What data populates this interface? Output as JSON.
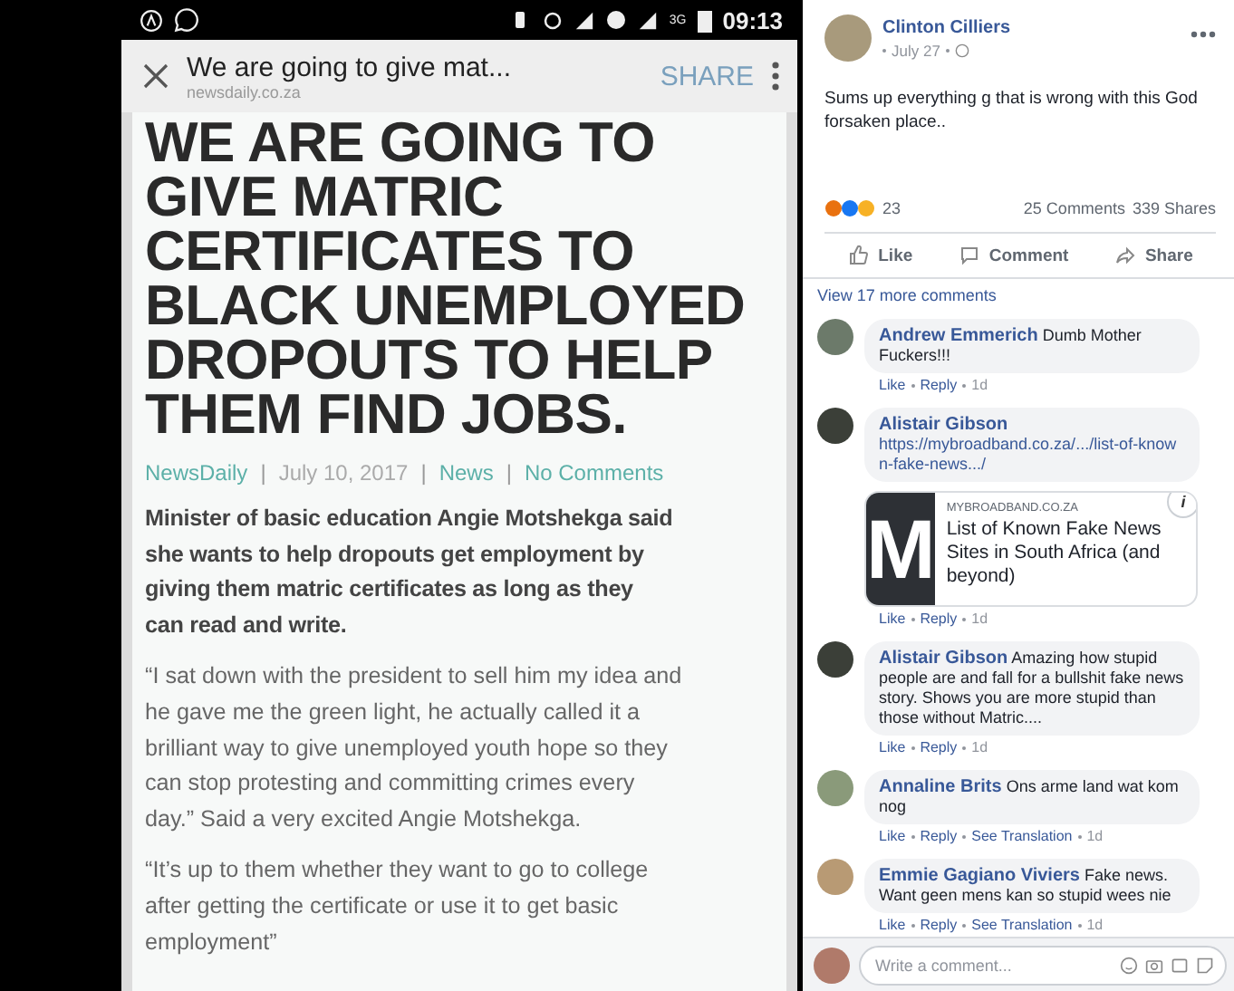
{
  "phone": {
    "status_bar": {
      "time": "09:13",
      "network": "3G"
    },
    "browser_bar": {
      "title": "We are going to give mat...",
      "url": "newsdaily.co.za",
      "share": "SHARE"
    },
    "article": {
      "headline": "WE ARE GOING TO GIVE MATRIC CERTIFICATES TO BLACK UNEMPLOYED DROPOUTS TO HELP THEM FIND JOBS.",
      "meta": [
        {
          "text": "NewsDaily",
          "kind": "link"
        },
        {
          "text": "|",
          "kind": "sep"
        },
        {
          "text": "July 10, 2017",
          "kind": "plain"
        },
        {
          "text": "|",
          "kind": "sep"
        },
        {
          "text": "News",
          "kind": "link"
        },
        {
          "text": "|",
          "kind": "sep"
        },
        {
          "text": "No Comments",
          "kind": "link"
        }
      ],
      "paragraphs": [
        {
          "text": "Minister of basic education Angie Motshekga said she wants to help dropouts get employment by giving them matric certificates as long as they can read and write.",
          "bold": true
        },
        {
          "text": "“I sat down with the president to sell him my idea and he gave me the green light, he actually called it a brilliant way to give unemployed youth hope so they can stop protesting and committing crimes every day.” Said a very excited Angie Motshekga.",
          "bold": false
        },
        {
          "text": "“It’s up to them whether they want to go to college after getting the certificate or use it to get basic employment”",
          "bold": false
        }
      ]
    }
  },
  "post": {
    "author": "Clinton Cilliers",
    "date": "July 27",
    "text": "Sums up everything g that is wrong with this God forsaken place..",
    "reaction_count": "23",
    "comments_count": "25 Comments",
    "shares_count": "339 Shares",
    "actions": [
      {
        "label": "Like",
        "kind": "like"
      },
      {
        "label": "Comment",
        "kind": "comment"
      },
      {
        "label": "Share",
        "kind": "share"
      }
    ],
    "view_more": "View 17 more comments",
    "comments": [
      {
        "author": "Andrew Emmerich",
        "text": "Dumb Mother Fuckers!!!",
        "actions": [
          "Like",
          "Reply"
        ],
        "time": "1d"
      },
      {
        "author": "Alistair Gibson",
        "link": "https://mybroadband.co.za/.../list-of-known-fake-news.../",
        "preview": {
          "logo": "M",
          "info": "i",
          "site": "MYBROADBAND.CO.ZA",
          "title": "List of Known Fake News Sites in South Africa (and beyond)"
        },
        "actions": [
          "Like",
          "Reply"
        ],
        "time": "1d"
      },
      {
        "author": "Alistair Gibson",
        "text": "Amazing how stupid people are and fall for a bullshit fake news story. Shows you are more stupid than those without Matric....",
        "actions": [
          "Like",
          "Reply"
        ],
        "time": "1d"
      },
      {
        "author": "Annaline Brits",
        "text": "Ons arme land wat kom nog",
        "actions": [
          "Like",
          "Reply",
          "See Translation"
        ],
        "time": "1d"
      },
      {
        "author": "Emmie Gagiano Viviers",
        "text": "Fake news. Want geen mens kan so stupid wees nie",
        "actions": [
          "Like",
          "Reply",
          "See Translation"
        ],
        "time": "1d"
      }
    ],
    "composer": {
      "placeholder": "Write a comment..."
    }
  }
}
